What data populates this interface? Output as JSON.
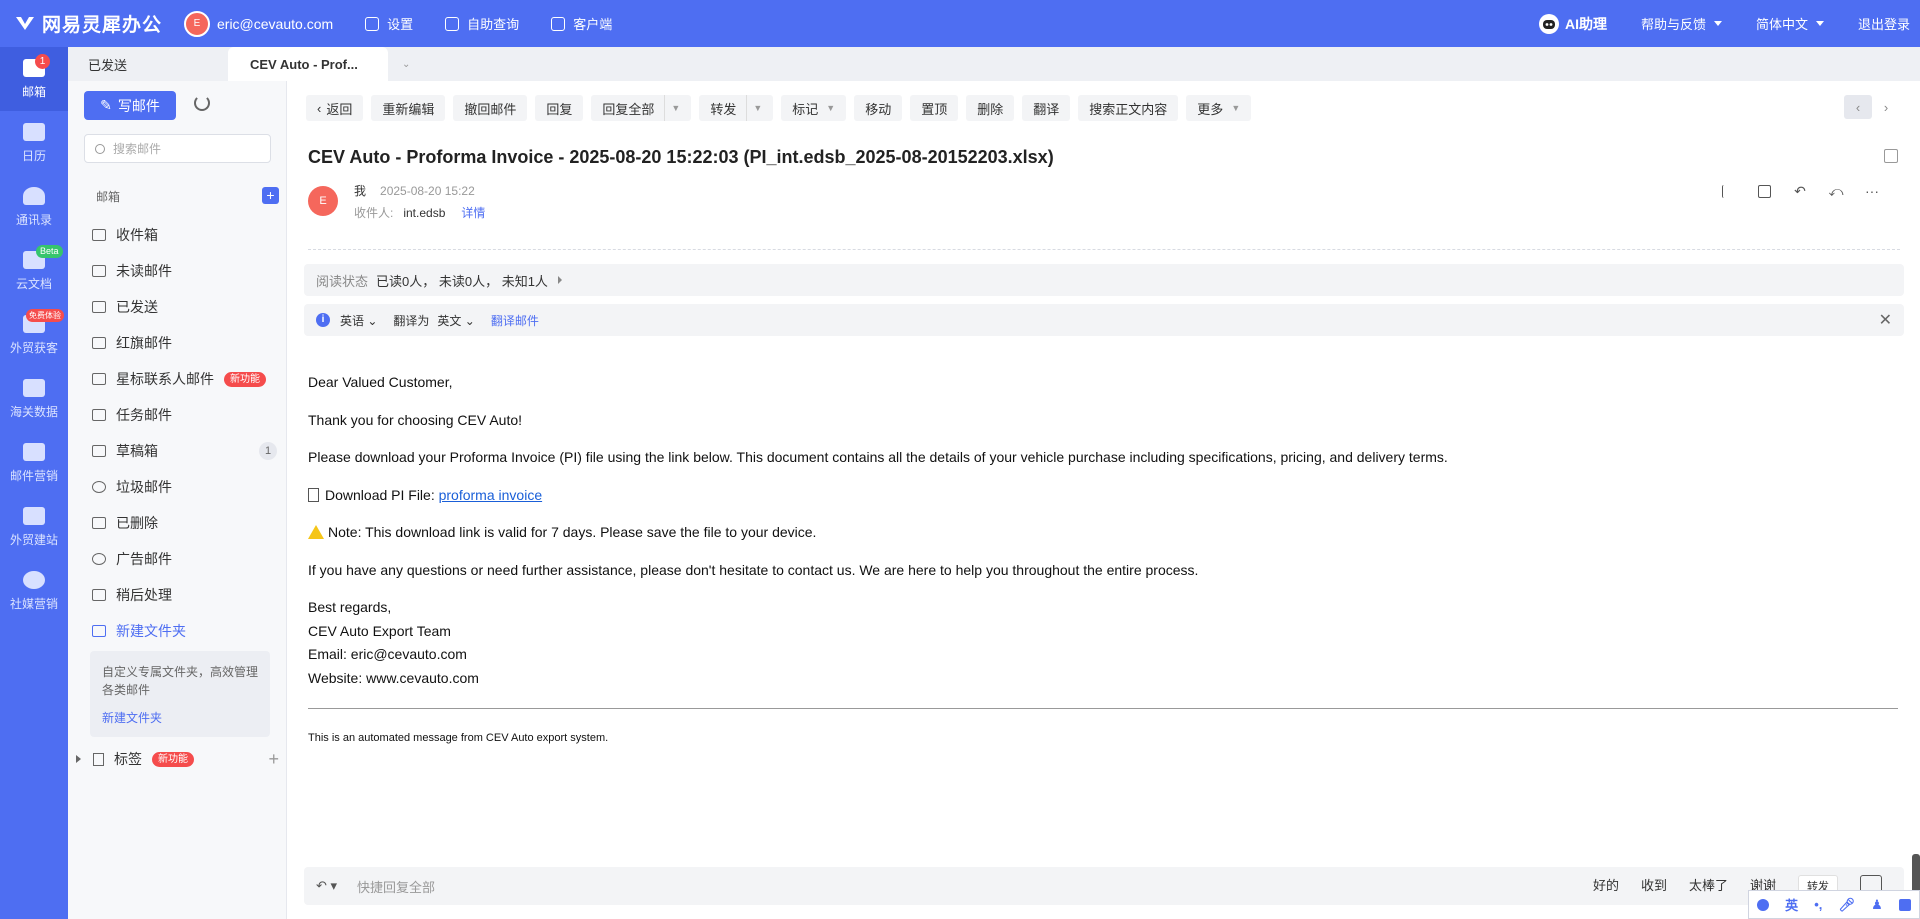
{
  "brand": {
    "name": "网易灵犀办公"
  },
  "account": {
    "avatar": "E",
    "email": "eric@cevauto.com"
  },
  "topnav": [
    "设置",
    "自助查询",
    "客户端"
  ],
  "topright": {
    "ai": "AI助理",
    "help": "帮助与反馈",
    "lang": "简体中文",
    "logout": "退出登录"
  },
  "rail": [
    {
      "label": "邮箱",
      "badge": "1"
    },
    {
      "label": "日历"
    },
    {
      "label": "通讯录"
    },
    {
      "label": "云文档",
      "badge": "Beta"
    },
    {
      "label": "外贸获客",
      "badge": "免费体验"
    },
    {
      "label": "海关数据"
    },
    {
      "label": "邮件营销"
    },
    {
      "label": "外贸建站"
    },
    {
      "label": "社媒营销"
    }
  ],
  "tabs": {
    "tab1": "已发送",
    "tab2": "CEV Auto - Prof..."
  },
  "sidebar": {
    "compose": "写邮件",
    "search_placeholder": "搜索邮件",
    "section": "邮箱",
    "folders": [
      {
        "label": "收件箱"
      },
      {
        "label": "未读邮件"
      },
      {
        "label": "已发送"
      },
      {
        "label": "红旗邮件"
      },
      {
        "label": "星标联系人邮件",
        "tag": "新功能"
      },
      {
        "label": "任务邮件"
      },
      {
        "label": "草稿箱",
        "count": "1"
      },
      {
        "label": "垃圾邮件"
      },
      {
        "label": "已删除"
      },
      {
        "label": "广告邮件"
      },
      {
        "label": "稍后处理"
      },
      {
        "label": "新建文件夹"
      }
    ],
    "promo": {
      "text": "自定义专属文件夹，高效管理各类邮件",
      "link": "新建文件夹"
    },
    "labels": {
      "label": "标签",
      "tag": "新功能"
    }
  },
  "toolbar": {
    "back": "返回",
    "reedit": "重新编辑",
    "recall": "撤回邮件",
    "reply": "回复",
    "replyall": "回复全部",
    "forward": "转发",
    "mark": "标记",
    "move": "移动",
    "top": "置顶",
    "delete": "删除",
    "translate": "翻译",
    "searchbody": "搜索正文内容",
    "more": "更多"
  },
  "mail": {
    "subject": "CEV Auto - Proforma Invoice - 2025-08-20 15:22:03 (PI_int.edsb_2025-08-20152203.xlsx)",
    "sender_avatar": "E",
    "sender": "我",
    "date": "2025-08-20 15:22",
    "recipient_label": "收件人:",
    "recipient": "int.edsb",
    "details": "详情",
    "read_status_label": "阅读状态",
    "read_status": "已读0人， 未读0人， 未知1人",
    "trans_from": "英语",
    "trans_to_label": "翻译为",
    "trans_to": "英文",
    "trans_link": "翻译邮件",
    "body": {
      "greeting": "Dear Valued Customer,",
      "thanks": "Thank you for choosing CEV Auto!",
      "p1": "Please download your Proforma Invoice (PI) file using the link below. This document contains all the details of your vehicle purchase including specifications, pricing, and delivery terms.",
      "dl_label": "Download PI File:",
      "dl_link": "proforma invoice",
      "note": "Note: This download link is valid for 7 days. Please save the file to your device.",
      "p2": "If you have any questions or need further assistance, please don't hesitate to contact us. We are here to help you throughout the entire process.",
      "regards": "Best regards,",
      "team": "CEV Auto Export Team",
      "email": "Email: eric@cevauto.com",
      "website": "Website: www.cevauto.com",
      "footer": "This is an automated message from CEV Auto export system."
    }
  },
  "replybar": {
    "placeholder": "快捷回复全部",
    "quick": [
      "好的",
      "收到",
      "太棒了",
      "谢谢"
    ],
    "forward": "转发"
  },
  "ime": {
    "lang": "英"
  }
}
